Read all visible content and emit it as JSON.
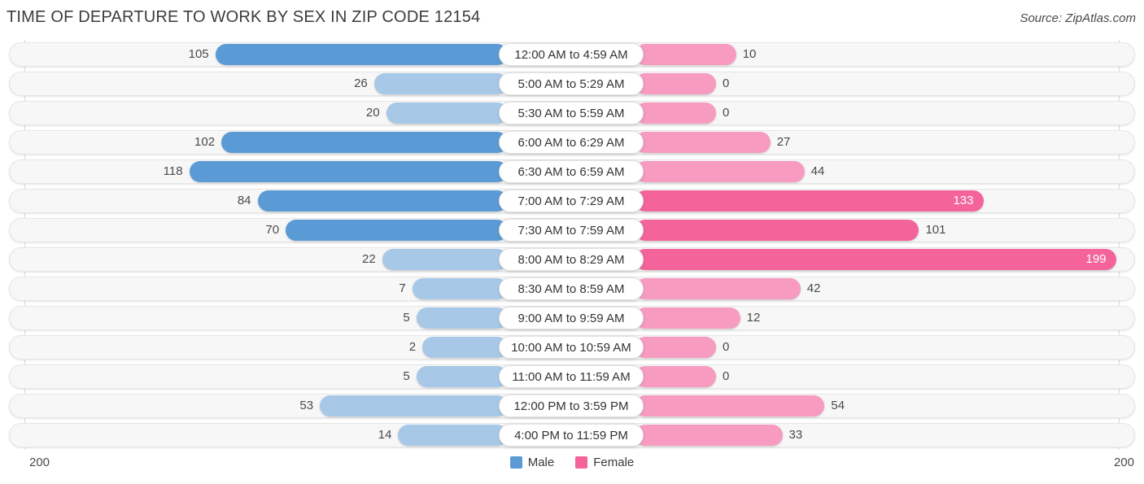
{
  "header": {
    "title": "TIME OF DEPARTURE TO WORK BY SEX IN ZIP CODE 12154",
    "source": "Source: ZipAtlas.com"
  },
  "legend": {
    "male_label": "Male",
    "female_label": "Female",
    "male_color": "#5b9bd5",
    "female_color": "#f4649a"
  },
  "axis": {
    "left_tick": "200",
    "right_tick": "200",
    "max": 200
  },
  "colors": {
    "male_dark": "#5b9bd5",
    "male_light": "#a8c8e8",
    "female_dark": "#f4649a",
    "female_light": "#f79bc0",
    "track": "#f7f7f7",
    "track_border": "#e6e6e6"
  },
  "chart_data": {
    "type": "bar",
    "orientation": "horizontal",
    "layout": "diverging-bidirectional",
    "title": "TIME OF DEPARTURE TO WORK BY SEX IN ZIP CODE 12154",
    "xlabel": "",
    "ylabel": "",
    "xlim": [
      200,
      200
    ],
    "grid": false,
    "legend_position": "bottom-center",
    "categories": [
      "12:00 AM to 4:59 AM",
      "5:00 AM to 5:29 AM",
      "5:30 AM to 5:59 AM",
      "6:00 AM to 6:29 AM",
      "6:30 AM to 6:59 AM",
      "7:00 AM to 7:29 AM",
      "7:30 AM to 7:59 AM",
      "8:00 AM to 8:29 AM",
      "8:30 AM to 8:59 AM",
      "9:00 AM to 9:59 AM",
      "10:00 AM to 10:59 AM",
      "11:00 AM to 11:59 AM",
      "12:00 PM to 3:59 PM",
      "4:00 PM to 11:59 PM"
    ],
    "series": [
      {
        "name": "Male",
        "color": "#5b9bd5",
        "values": [
          105,
          26,
          20,
          102,
          118,
          84,
          70,
          22,
          7,
          5,
          2,
          5,
          53,
          14
        ]
      },
      {
        "name": "Female",
        "color": "#f4649a",
        "values": [
          10,
          0,
          0,
          27,
          44,
          133,
          101,
          199,
          42,
          12,
          0,
          0,
          54,
          33
        ]
      }
    ]
  },
  "rows": [
    {
      "label": "12:00 AM to 4:59 AM",
      "male": "105",
      "female": "10"
    },
    {
      "label": "5:00 AM to 5:29 AM",
      "male": "26",
      "female": "0"
    },
    {
      "label": "5:30 AM to 5:59 AM",
      "male": "20",
      "female": "0"
    },
    {
      "label": "6:00 AM to 6:29 AM",
      "male": "102",
      "female": "27"
    },
    {
      "label": "6:30 AM to 6:59 AM",
      "male": "118",
      "female": "44"
    },
    {
      "label": "7:00 AM to 7:29 AM",
      "male": "84",
      "female": "133"
    },
    {
      "label": "7:30 AM to 7:59 AM",
      "male": "70",
      "female": "101"
    },
    {
      "label": "8:00 AM to 8:29 AM",
      "male": "22",
      "female": "199"
    },
    {
      "label": "8:30 AM to 8:59 AM",
      "male": "7",
      "female": "42"
    },
    {
      "label": "9:00 AM to 9:59 AM",
      "male": "5",
      "female": "12"
    },
    {
      "label": "10:00 AM to 10:59 AM",
      "male": "2",
      "female": "0"
    },
    {
      "label": "11:00 AM to 11:59 AM",
      "male": "5",
      "female": "0"
    },
    {
      "label": "12:00 PM to 3:59 PM",
      "male": "53",
      "female": "54"
    },
    {
      "label": "4:00 PM to 11:59 PM",
      "male": "14",
      "female": "33"
    }
  ]
}
